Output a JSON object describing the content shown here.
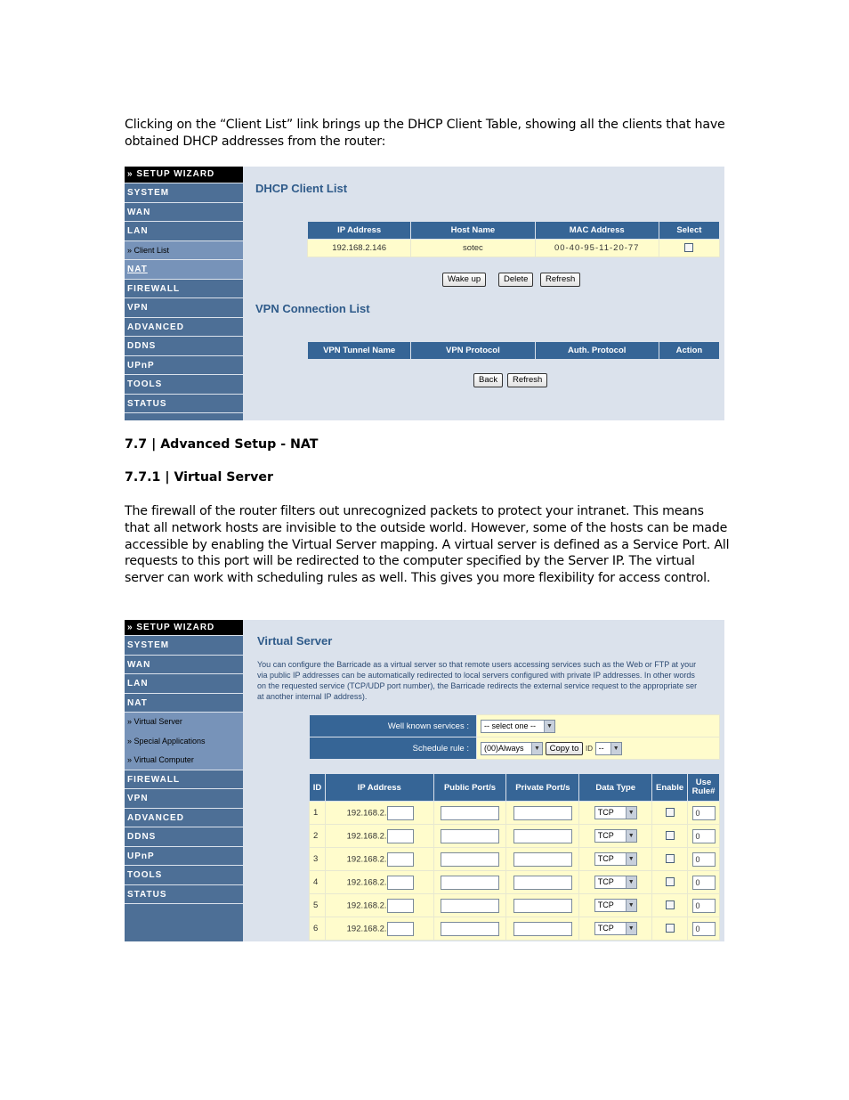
{
  "intro": "Clicking on the “Client List” link brings up the DHCP Client Table, showing all the clients that have obtained DHCP addresses from the router:",
  "section_heading": "7.7 | Advanced Setup - NAT",
  "subsection_heading": "7.7.1 | Virtual Server",
  "body_text": "The firewall of the router filters out unrecognized packets to protect your intranet. This means that all network hosts are invisible to the outside world. However, some of the hosts can be made accessible by enabling the Virtual Server mapping. A virtual server is defined as a Service Port. All requests to this port will be redirected to the computer specified by the Server IP. The virtual server can work with scheduling rules as well. This gives you more flexibility for access control.",
  "screenshot1": {
    "nav": [
      "» SETUP WIZARD",
      "SYSTEM",
      "WAN",
      "LAN",
      "» Client List",
      "NAT",
      "FIREWALL",
      "VPN",
      "ADVANCED",
      "DDNS",
      "UPnP",
      "TOOLS",
      "STATUS"
    ],
    "dhcp_title": "DHCP Client List",
    "dhcp_headers": [
      "IP Address",
      "Host Name",
      "MAC Address",
      "Select"
    ],
    "dhcp_rows": [
      {
        "ip": "192.168.2.146",
        "host": "sotec",
        "mac": "00-40-95-11-20-77",
        "selected": false
      }
    ],
    "buttons": {
      "wake": "Wake up",
      "delete": "Delete",
      "refresh": "Refresh",
      "back": "Back"
    },
    "vpn_title": "VPN Connection List",
    "vpn_headers": [
      "VPN Tunnel Name",
      "VPN Protocol",
      "Auth. Protocol",
      "Action"
    ]
  },
  "screenshot2": {
    "nav": [
      "» SETUP WIZARD",
      "SYSTEM",
      "WAN",
      "LAN",
      "NAT",
      "» Virtual Server",
      "» Special Applications",
      "» Virtual Computer",
      "FIREWALL",
      "VPN",
      "ADVANCED",
      "DDNS",
      "UPnP",
      "TOOLS",
      "STATUS"
    ],
    "title": "Virtual Server",
    "desc_lines": [
      "You can configure the Barricade as a virtual server so that remote users accessing services such as the Web or FTP at your",
      "via public IP addresses can be automatically redirected to local servers configured with private IP addresses. In other words",
      "on the requested service (TCP/UDP port number), the Barricade redirects the external service request to the appropriate ser",
      "at another internal IP address)."
    ],
    "well_known_label": "Well known services :",
    "well_known_value": "-- select one --",
    "schedule_label": "Schedule rule :",
    "schedule_value": "(00)Always",
    "copy_to": "Copy to",
    "id_label": "ID",
    "id_value": "--",
    "headers": [
      "ID",
      "IP Address",
      "Public Port/s",
      "Private Port/s",
      "Data Type",
      "Enable",
      "Use Rule#"
    ],
    "ip_prefix": "192.168.2.",
    "rows": [
      {
        "id": "1",
        "type": "TCP",
        "rule": "0"
      },
      {
        "id": "2",
        "type": "TCP",
        "rule": "0"
      },
      {
        "id": "3",
        "type": "TCP",
        "rule": "0"
      },
      {
        "id": "4",
        "type": "TCP",
        "rule": "0"
      },
      {
        "id": "5",
        "type": "TCP",
        "rule": "0"
      },
      {
        "id": "6",
        "type": "TCP",
        "rule": "0"
      }
    ]
  }
}
